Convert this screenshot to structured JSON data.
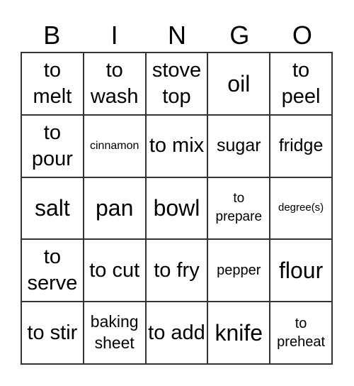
{
  "header": [
    "B",
    "I",
    "N",
    "G",
    "O"
  ],
  "cells": [
    [
      "to melt",
      "to wash",
      "stove top",
      "oil",
      "to peel"
    ],
    [
      "to pour",
      "cinnamon",
      "to mix",
      "sugar",
      "fridge"
    ],
    [
      "salt",
      "pan",
      "bowl",
      "to prepare",
      "degree(s)"
    ],
    [
      "to serve",
      "to cut",
      "to fry",
      "pepper",
      "flour"
    ],
    [
      "to stir",
      "baking sheet",
      "to add",
      "knife",
      "to preheat"
    ]
  ]
}
